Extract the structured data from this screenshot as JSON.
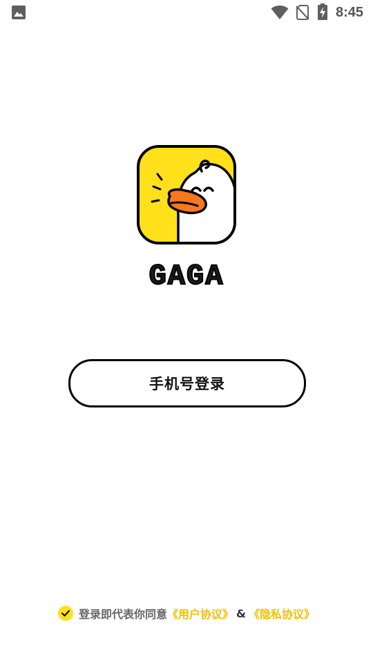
{
  "status_bar": {
    "time": "8:45",
    "icons": [
      "gallery-icon",
      "wifi-icon",
      "no-sim-icon",
      "battery-charging-icon"
    ]
  },
  "app": {
    "name": "GAGA",
    "logo_icon": "duck-logo-icon"
  },
  "login": {
    "phone_button_label": "手机号登录"
  },
  "agreement": {
    "checked": true,
    "prefix": "登录即代表你同意",
    "user_agreement": "《用户协议》",
    "separator": "&",
    "privacy_agreement": "《隐私协议》"
  },
  "colors": {
    "accent_yellow": "#FFE01B",
    "link_yellow": "#F5BE00",
    "duck_bill_orange": "#F6781F",
    "text_gray": "#666666"
  }
}
